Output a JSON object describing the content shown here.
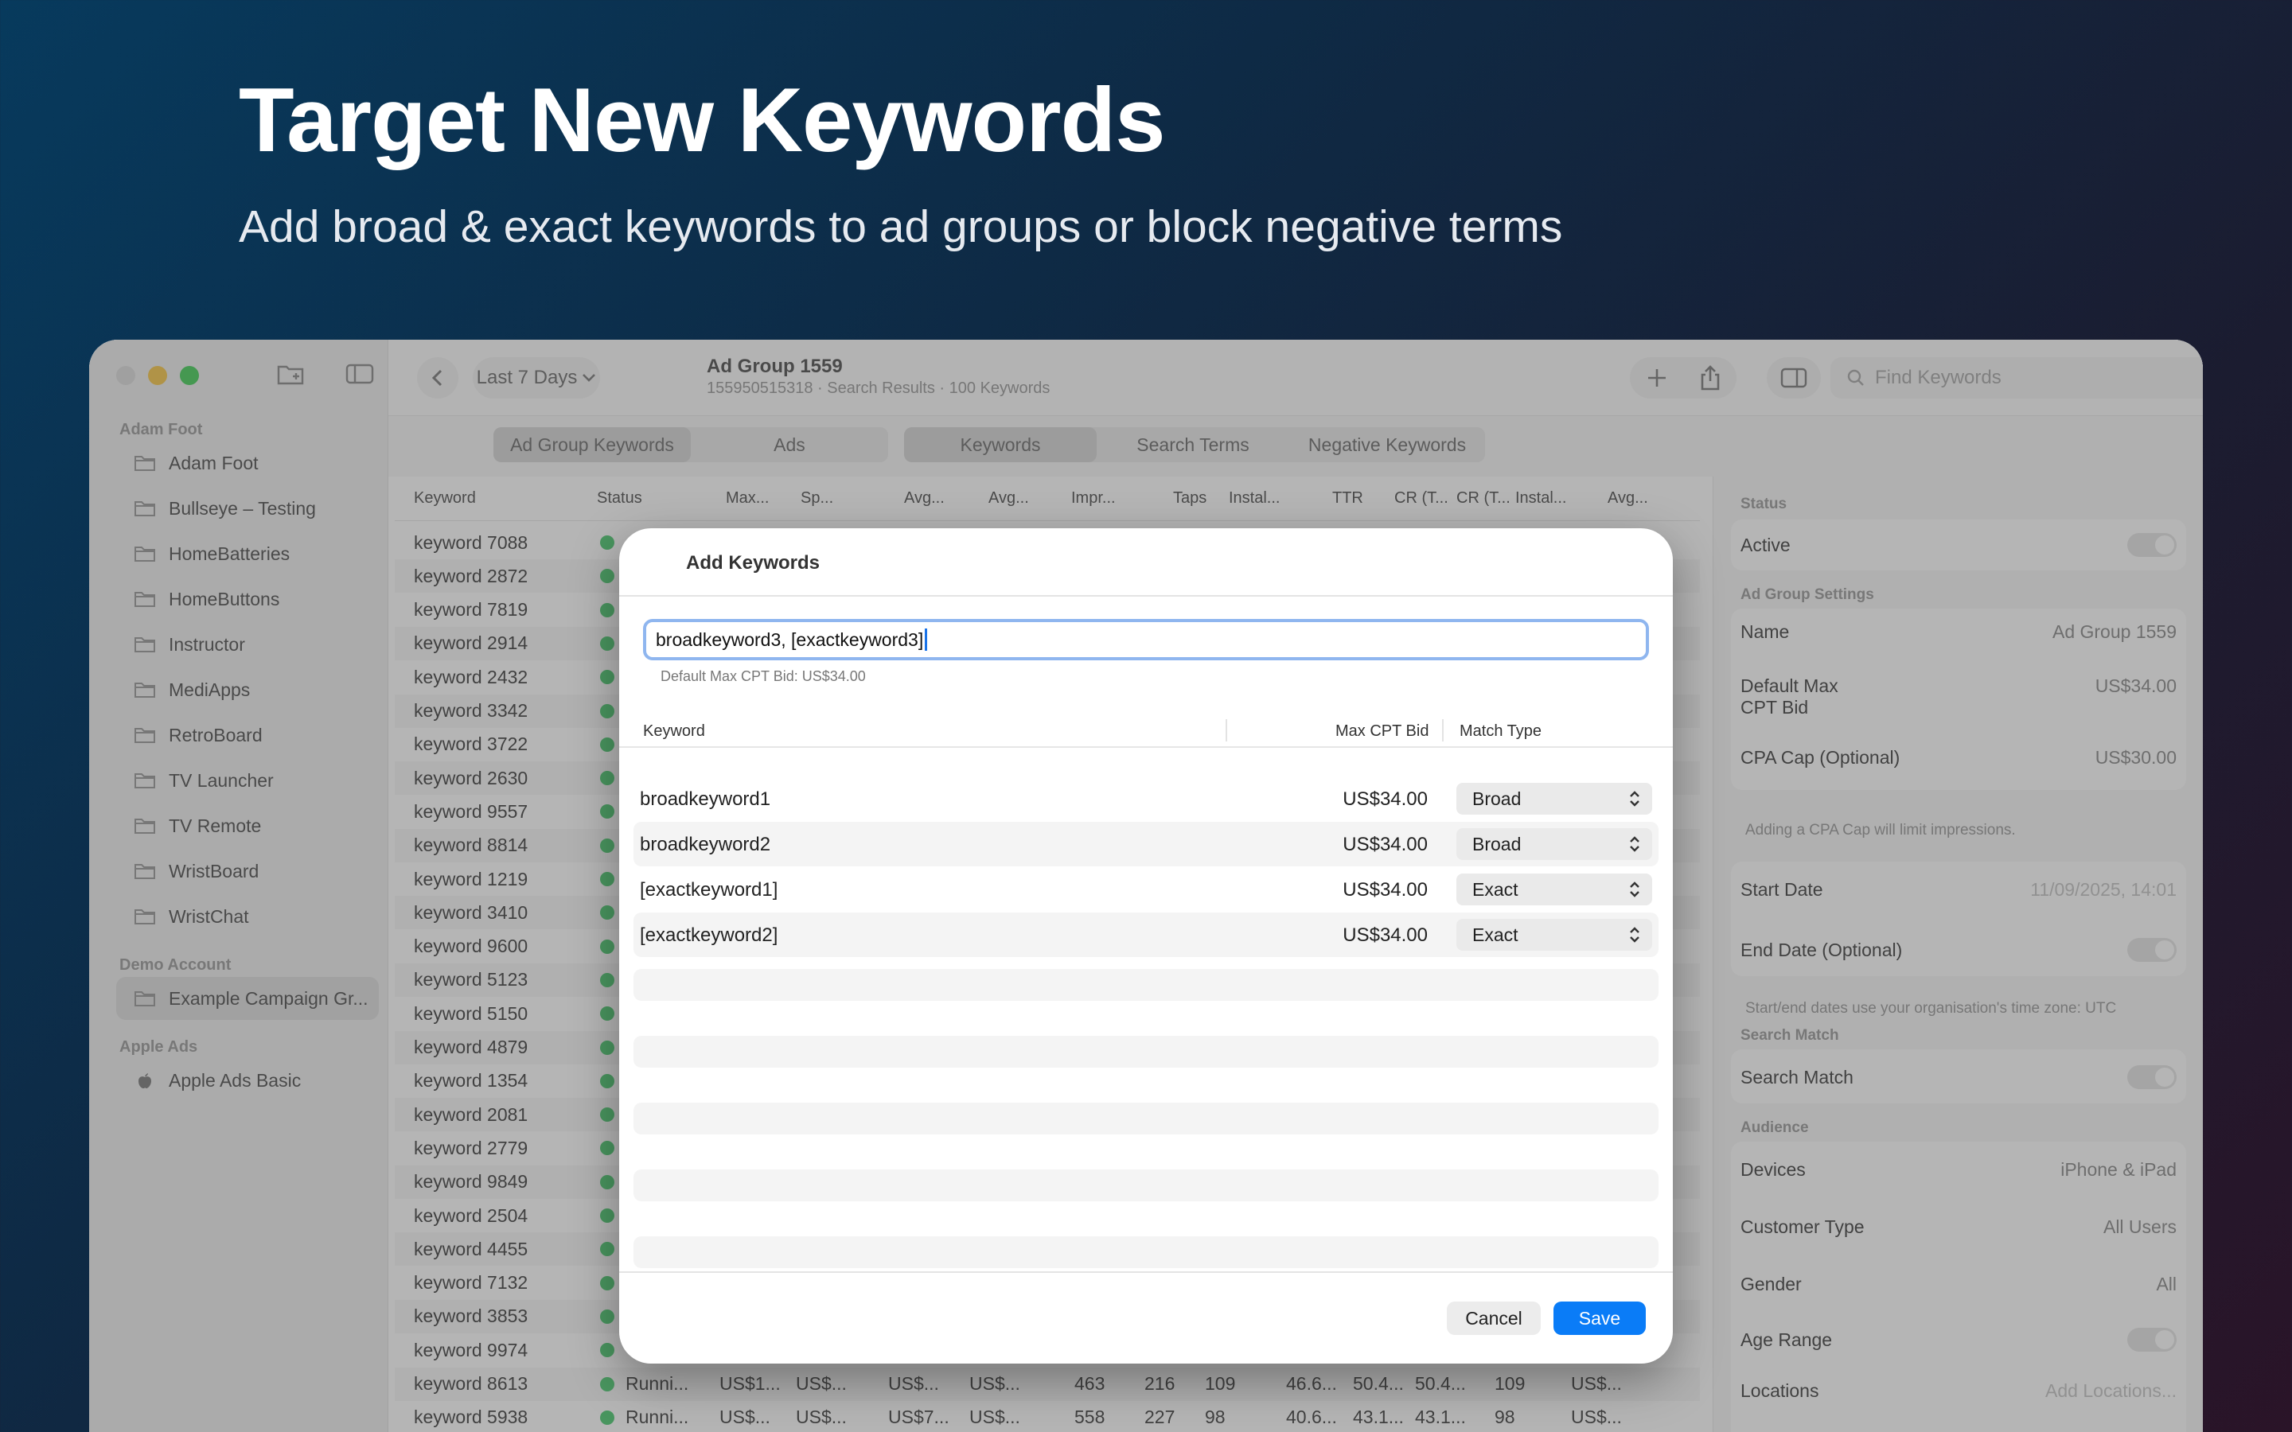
{
  "hero": {
    "title": "Target New Keywords",
    "subtitle": "Add broad & exact keywords to ad groups or block negative terms"
  },
  "toolbar": {
    "date_range": "Last 7 Days",
    "title": "Ad Group 1559",
    "subtitle": "155950515318 · Search Results · 100 Keywords",
    "search_placeholder": "Find Keywords"
  },
  "sidebar": {
    "sections": [
      {
        "title": "Adam Foot",
        "items": [
          "Adam Foot",
          "Bullseye – Testing",
          "HomeBatteries",
          "HomeButtons",
          "Instructor",
          "MediApps",
          "RetroBoard",
          "TV Launcher",
          "TV Remote",
          "WristBoard",
          "WristChat"
        ]
      },
      {
        "title": "Demo Account",
        "items": [
          "Example Campaign Gr..."
        ]
      },
      {
        "title": "Apple Ads",
        "items": [
          "Apple Ads Basic"
        ]
      }
    ]
  },
  "tabs": {
    "left": [
      "Ad Group Keywords",
      "Ads"
    ],
    "right": [
      "Keywords",
      "Search Terms",
      "Negative Keywords"
    ]
  },
  "table": {
    "columns": [
      "Keyword",
      "Status",
      "Max...",
      "Sp...",
      "Avg...",
      "Avg...",
      "Impr...",
      "Taps",
      "Instal...",
      "TTR",
      "CR (T...",
      "CR (T...",
      "Instal...",
      "Avg..."
    ],
    "keywords": [
      "keyword 7088",
      "keyword 2872",
      "keyword 7819",
      "keyword 2914",
      "keyword 2432",
      "keyword 3342",
      "keyword 3722",
      "keyword 2630",
      "keyword 9557",
      "keyword 8814",
      "keyword 1219",
      "keyword 3410",
      "keyword 9600",
      "keyword 5123",
      "keyword 5150",
      "keyword 4879",
      "keyword 1354",
      "keyword 2081",
      "keyword 2779",
      "keyword 9849",
      "keyword 2504",
      "keyword 4455",
      "keyword 7132",
      "keyword 3853",
      "keyword 9974",
      "keyword 8613",
      "keyword 5938"
    ],
    "visible_rows": [
      {
        "status": "Runni...",
        "max": "US$1...",
        "sp": "US$...",
        "avg1": "US$...",
        "avg2": "US$...",
        "impr": "463",
        "taps": "216",
        "inst": "109",
        "ttr": "46.6...",
        "cr1": "50.4...",
        "cr2": "50.4...",
        "inst2": "109",
        "avg3": "US$..."
      },
      {
        "status": "Runni...",
        "max": "US$...",
        "sp": "US$...",
        "avg1": "US$7...",
        "avg2": "US$...",
        "impr": "558",
        "taps": "227",
        "inst": "98",
        "ttr": "40.6...",
        "cr1": "43.1...",
        "cr2": "43.1...",
        "inst2": "98",
        "avg3": "US$..."
      }
    ]
  },
  "inspector": {
    "status_label": "Status",
    "active": "Active",
    "settings_label": "Ad Group Settings",
    "name_label": "Name",
    "name_value": "Ad Group 1559",
    "default_bid_label": "Default Max CPT Bid",
    "default_bid_value": "US$34.00",
    "cpa_label": "CPA Cap (Optional)",
    "cpa_value": "US$30.00",
    "cpa_note": "Adding a CPA Cap will limit impressions.",
    "start_label": "Start Date",
    "start_value": "11/09/2025, 14:01",
    "end_label": "End Date (Optional)",
    "tz_note": "Start/end dates use your organisation's time zone: UTC",
    "search_match_section": "Search Match",
    "search_match_label": "Search Match",
    "audience_label": "Audience",
    "devices_label": "Devices",
    "devices_value": "iPhone & iPad",
    "customer_label": "Customer Type",
    "customer_value": "All Users",
    "gender_label": "Gender",
    "gender_value": "All",
    "age_label": "Age Range",
    "locations_label": "Locations",
    "locations_value": "Add Locations..."
  },
  "modal": {
    "title": "Add Keywords",
    "input_value": "broadkeyword3, [exactkeyword3]",
    "hint": "Default Max CPT Bid: US$34.00",
    "col_keyword": "Keyword",
    "col_bid": "Max CPT Bid",
    "col_match": "Match Type",
    "rows": [
      {
        "keyword": "broadkeyword1",
        "bid": "US$34.00",
        "match": "Broad"
      },
      {
        "keyword": "broadkeyword2",
        "bid": "US$34.00",
        "match": "Broad"
      },
      {
        "keyword": "[exactkeyword1]",
        "bid": "US$34.00",
        "match": "Exact"
      },
      {
        "keyword": "[exactkeyword2]",
        "bid": "US$34.00",
        "match": "Exact"
      }
    ],
    "cancel": "Cancel",
    "save": "Save"
  },
  "colors": {
    "accent": "#0a7cf7",
    "status_green": "#31c15a",
    "focus_ring": "#8fb6ef"
  }
}
